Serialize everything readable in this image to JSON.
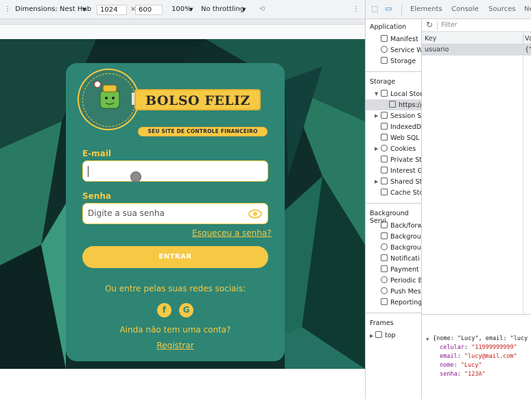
{
  "devtools_bar": {
    "dimensions_label": "Dimensions: Nest Hub",
    "width": "1024",
    "height": "600",
    "zoom": "100%",
    "throttling": "No throttling"
  },
  "app": {
    "brand_title": "BOLSO FELIZ",
    "brand_subtitle": "SEU SITE DE CONTROLE FINANCEIRO",
    "email_label": "E-mail",
    "email_value": "",
    "password_label": "Senha",
    "password_placeholder": "Digite a sua senha",
    "forgot_link": "Esqueceu a senha?",
    "submit_label": "ENTRAR",
    "social_text": "Ou entre pelas suas redes sociais:",
    "no_account_text": "Ainda não tem uma conta?",
    "register_link": "Registrar",
    "colors": {
      "card": "#2e8574",
      "accent": "#f6c945"
    }
  },
  "devtools": {
    "tabs": [
      "Elements",
      "Console",
      "Sources",
      "Ne"
    ],
    "filter_placeholder": "Filter",
    "sidebar": {
      "application_heading": "Application",
      "application_items": [
        "Manifest",
        "Service W",
        "Storage"
      ],
      "storage_heading": "Storage",
      "storage_items": [
        "Local Stor",
        "https://",
        "Session St",
        "IndexedD",
        "Web SQL",
        "Cookies",
        "Private St",
        "Interest G",
        "Shared St",
        "Cache Sto"
      ],
      "background_heading": "Background Servi",
      "background_items": [
        "Back/forw",
        "Backgrou",
        "Backgrou",
        "Notificati",
        "Payment",
        "Periodic B",
        "Push Mes",
        "Reporting"
      ],
      "frames_heading": "Frames",
      "frames_items": [
        "top"
      ]
    },
    "table": {
      "col_key": "Key",
      "col_value": "Va",
      "rows": [
        {
          "key": "usuario",
          "value": "{\"n"
        }
      ]
    },
    "console": {
      "summary": "{nome: \"Lucy\", email: \"lucy",
      "entries": [
        {
          "key": "celular",
          "value": "\"11999999999\""
        },
        {
          "key": "email",
          "value": "\"lucy@mail.com\""
        },
        {
          "key": "nome",
          "value": "\"Lucy\""
        },
        {
          "key": "senha",
          "value": "\"123A\""
        }
      ]
    }
  }
}
